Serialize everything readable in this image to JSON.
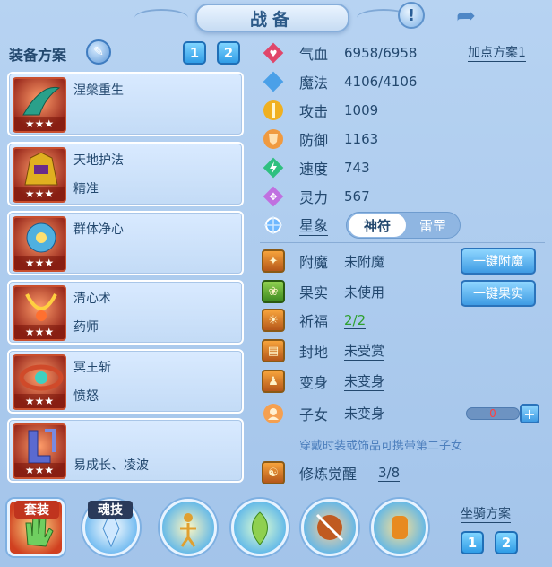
{
  "title": "战备",
  "plan": {
    "label": "装备方案",
    "tabs": [
      "1",
      "2"
    ]
  },
  "equipment": [
    {
      "name": "涅槃重生",
      "sub": "",
      "stars": "★★★",
      "color": "#2aa08a"
    },
    {
      "name": "天地护法",
      "sub": "精准",
      "stars": "★★★",
      "color": "#e0b020"
    },
    {
      "name": "群体净心",
      "sub": "",
      "stars": "★★★",
      "color": "#4fb0e0"
    },
    {
      "name": "清心术",
      "sub": "药师",
      "stars": "★★★",
      "color": "#e0a020"
    },
    {
      "name": "冥王斩",
      "sub": "愤怒",
      "stars": "★★★",
      "color": "#d04a2a"
    },
    {
      "name": "",
      "sub": "易成长、凌波",
      "stars": "★★★",
      "color": "#5a6ad0"
    }
  ],
  "stats": [
    {
      "label": "气血",
      "value": "6958/6958",
      "icon": "heart-icon",
      "color": "#e0466a"
    },
    {
      "label": "魔法",
      "value": "4106/4106",
      "icon": "mana-icon",
      "color": "#4aa0e8"
    },
    {
      "label": "攻击",
      "value": "1009",
      "icon": "attack-icon",
      "color": "#f0b020"
    },
    {
      "label": "防御",
      "value": "1163",
      "icon": "defense-icon",
      "color": "#f09a40"
    },
    {
      "label": "速度",
      "value": "743",
      "icon": "speed-icon",
      "color": "#2fc080"
    },
    {
      "label": "灵力",
      "value": "567",
      "icon": "spirit-icon",
      "color": "#c070e0"
    }
  ],
  "point_plan": "加点方案1",
  "star_sign": {
    "label": "星象",
    "options": [
      "神符",
      "雷罡"
    ]
  },
  "extras": [
    {
      "label": "附魔",
      "value": "未附魔",
      "underline": false
    },
    {
      "label": "果实",
      "value": "未使用",
      "underline": false
    },
    {
      "label": "祈福",
      "value": "2/2",
      "underline": true,
      "green": true
    },
    {
      "label": "封地",
      "value": "未受赏",
      "underline": true
    },
    {
      "label": "变身",
      "value": "未变身",
      "underline": true
    },
    {
      "label": "子女",
      "value": "未变身",
      "underline": true
    }
  ],
  "buttons": {
    "enchant": "一键附魔",
    "fruit": "一键果实"
  },
  "child_count": "0",
  "child_note": "穿戴时装或饰品可携带第二子女",
  "practice": {
    "label": "修炼觉醒",
    "value": "3/8"
  },
  "bottom": {
    "tab1": "套装",
    "tab2": "魂技",
    "mount_plan": "坐骑方案",
    "mount_tabs": [
      "1",
      "2"
    ]
  }
}
